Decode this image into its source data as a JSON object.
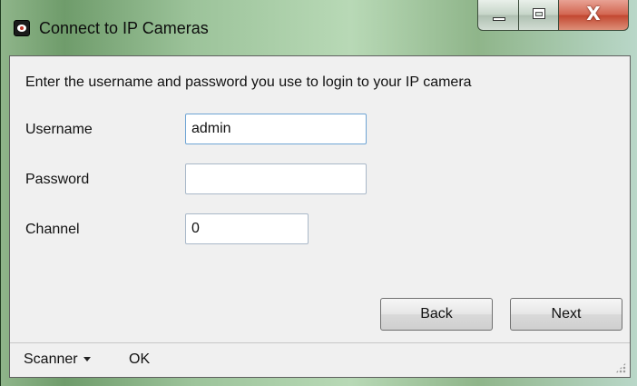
{
  "window": {
    "title": "Connect to IP Cameras",
    "icon": "camera-eye-icon",
    "controls": {
      "minimize": "minimize-icon",
      "maximize": "maximize-icon",
      "close_label": "X"
    }
  },
  "form": {
    "instructions": "Enter the username and password you use to login to your IP camera",
    "username_label": "Username",
    "username_value": "admin",
    "password_label": "Password",
    "password_value": "",
    "channel_label": "Channel",
    "channel_value": "0"
  },
  "buttons": {
    "back": "Back",
    "next": "Next"
  },
  "statusbar": {
    "dropdown_label": "Scanner",
    "status": "OK"
  },
  "colors": {
    "close_button": "#c2462f",
    "focus_border": "#6ea4d4"
  }
}
